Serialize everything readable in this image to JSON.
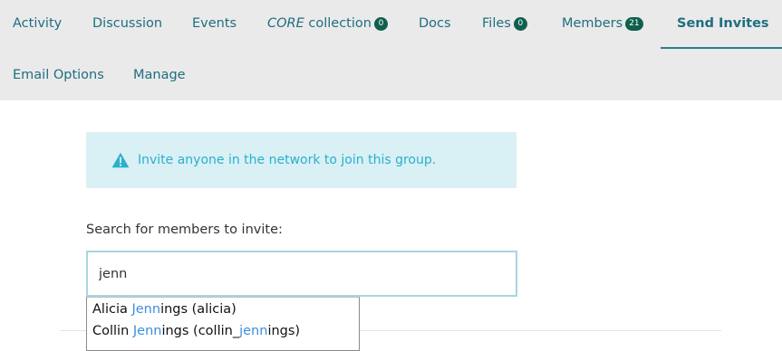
{
  "nav": {
    "items": [
      {
        "label": "Activity"
      },
      {
        "label": "Discussion"
      },
      {
        "label": "Events"
      },
      {
        "label_italic": "CORE",
        "label": " collection",
        "badge": "0"
      },
      {
        "label": "Docs"
      },
      {
        "label": "Files",
        "badge": "0"
      },
      {
        "label": "Members",
        "badge": "21"
      },
      {
        "label": "Send Invites",
        "active": true
      },
      {
        "label": "Email Options"
      },
      {
        "label": "Manage"
      }
    ]
  },
  "notice": {
    "icon": "warning-icon",
    "text": "Invite anyone in the network to join this group."
  },
  "search": {
    "label": "Search for members to invite:",
    "value": "jenn",
    "placeholder": ""
  },
  "suggestions": [
    {
      "before": "Alicia ",
      "match": "Jenn",
      "after": "ings (alicia)"
    },
    {
      "before": "Collin ",
      "match": "Jenn",
      "after": "ings (collin_",
      "match2": "jenn",
      "after2": "ings)"
    }
  ],
  "colors": {
    "nav_background": "#eaeaea",
    "nav_text": "#1f6e80",
    "badge": "#0f5f4e",
    "notice_background": "#d9f0f5",
    "notice_text": "#2bb0cc",
    "match_highlight": "#3b8fe0"
  }
}
